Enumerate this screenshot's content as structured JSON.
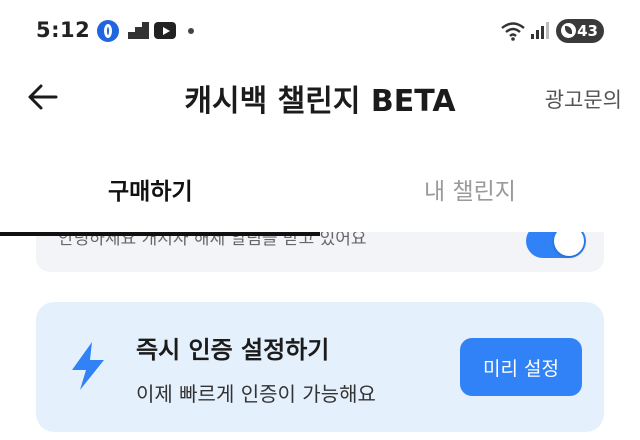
{
  "status_bar": {
    "time": "5:12",
    "battery": "43",
    "icons": [
      "opera-icon",
      "blocks-icon",
      "youtube-icon",
      "notification-dot-icon",
      "wifi-icon",
      "signal-icon",
      "battery-icon"
    ]
  },
  "header": {
    "title": "캐시백 챌린지 BETA",
    "ad_inquiry": "광고문의",
    "back_icon": "back-arrow-icon"
  },
  "tabs": [
    {
      "label": "구매하기",
      "active": true
    },
    {
      "label": "내 챌린지",
      "active": false
    }
  ],
  "prev_card": {
    "text": "안녕하세요 개시자 해제 알림을 받고 있어요",
    "toggle_on": true
  },
  "verify_card": {
    "title": "즉시 인증 설정하기",
    "subtitle": "이제 빠르게 인증이 가능해요",
    "button": "미리 설정",
    "icon": "lightning-bolt-icon"
  },
  "colors": {
    "accent": "#3182f6",
    "card_bg": "#e5f0fd",
    "gray_card": "#f3f4f7"
  }
}
